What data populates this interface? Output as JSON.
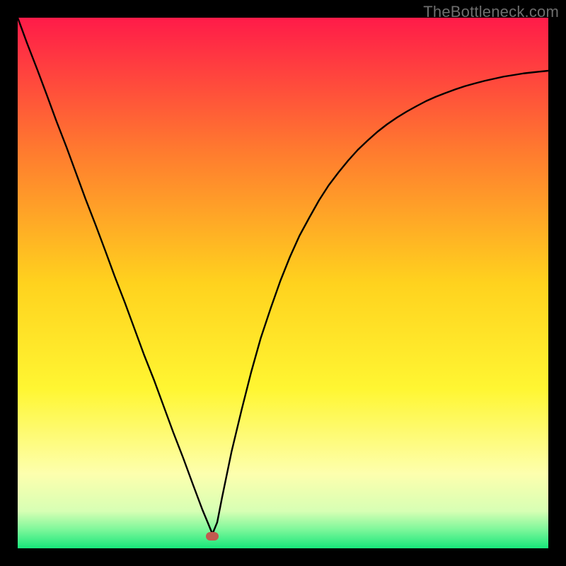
{
  "attribution": "TheBottleneck.com",
  "marker": {
    "color": "#c1594f",
    "x_frac": 0.367,
    "y_frac": 0.977
  },
  "chart_data": {
    "type": "line",
    "title": "",
    "xlabel": "",
    "ylabel": "",
    "xlim": [
      0,
      1
    ],
    "ylim": [
      0,
      1
    ],
    "gradient_stops": [
      {
        "offset": 0.0,
        "color": "#ff1b49"
      },
      {
        "offset": 0.25,
        "color": "#ff7a2f"
      },
      {
        "offset": 0.5,
        "color": "#ffd21e"
      },
      {
        "offset": 0.7,
        "color": "#fff632"
      },
      {
        "offset": 0.86,
        "color": "#fdffae"
      },
      {
        "offset": 0.93,
        "color": "#d7ffb4"
      },
      {
        "offset": 0.965,
        "color": "#7cf79a"
      },
      {
        "offset": 1.0,
        "color": "#17e67a"
      }
    ],
    "series": [
      {
        "name": "bottleneck-curve",
        "x": [
          0.0,
          0.018,
          0.037,
          0.055,
          0.073,
          0.092,
          0.11,
          0.128,
          0.147,
          0.165,
          0.183,
          0.202,
          0.22,
          0.238,
          0.257,
          0.275,
          0.293,
          0.312,
          0.33,
          0.348,
          0.358,
          0.367,
          0.376,
          0.385,
          0.403,
          0.422,
          0.44,
          0.458,
          0.477,
          0.495,
          0.513,
          0.531,
          0.55,
          0.568,
          0.586,
          0.605,
          0.623,
          0.641,
          0.66,
          0.678,
          0.696,
          0.715,
          0.733,
          0.751,
          0.77,
          0.788,
          0.806,
          0.825,
          0.843,
          0.861,
          0.88,
          0.898,
          0.916,
          0.935,
          0.953,
          0.971,
          0.99,
          1.0
        ],
        "values": [
          1.0,
          0.951,
          0.902,
          0.854,
          0.805,
          0.756,
          0.707,
          0.658,
          0.609,
          0.561,
          0.512,
          0.463,
          0.414,
          0.365,
          0.317,
          0.268,
          0.219,
          0.17,
          0.121,
          0.073,
          0.049,
          0.027,
          0.049,
          0.095,
          0.182,
          0.261,
          0.332,
          0.396,
          0.453,
          0.504,
          0.549,
          0.589,
          0.624,
          0.656,
          0.684,
          0.709,
          0.731,
          0.751,
          0.769,
          0.785,
          0.799,
          0.812,
          0.823,
          0.833,
          0.843,
          0.851,
          0.858,
          0.865,
          0.871,
          0.876,
          0.881,
          0.885,
          0.889,
          0.892,
          0.895,
          0.897,
          0.899,
          0.9
        ]
      }
    ],
    "annotations": [
      {
        "name": "operating-point",
        "x": 0.367,
        "y": 0.023
      }
    ]
  }
}
